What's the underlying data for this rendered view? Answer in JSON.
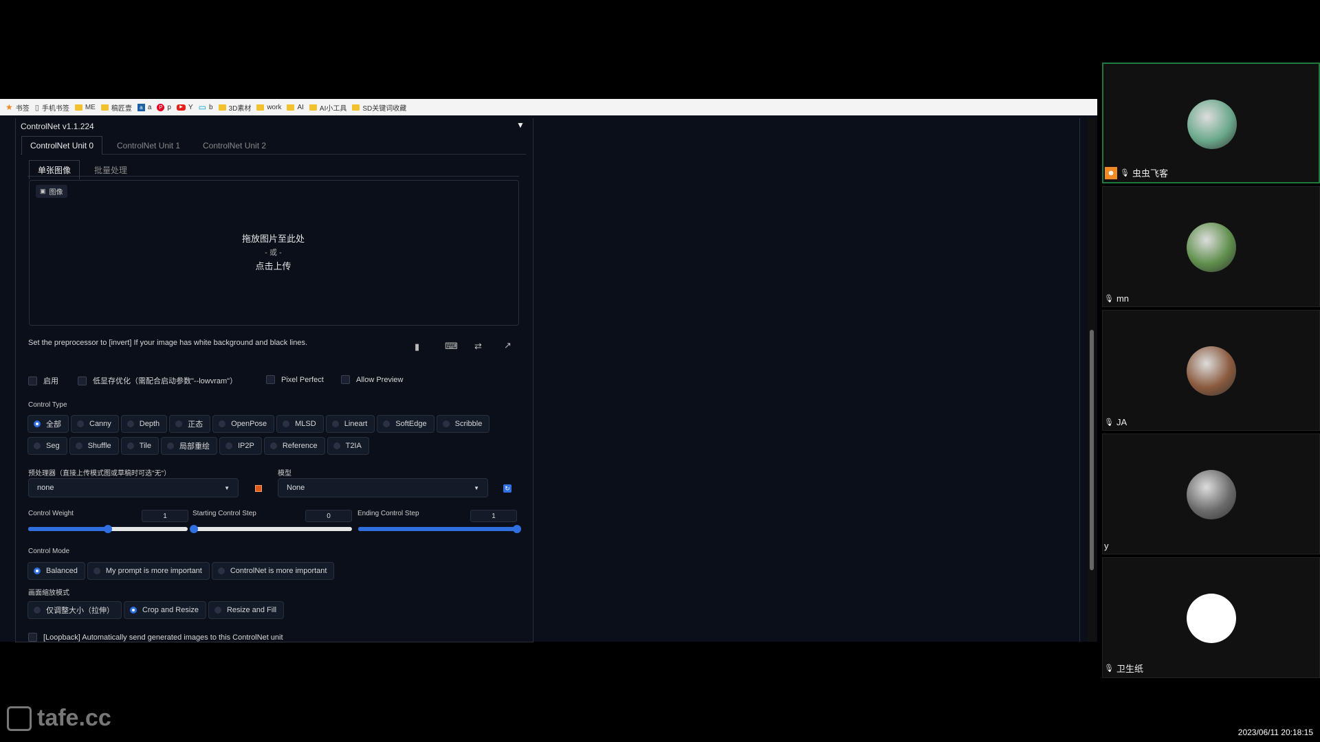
{
  "bookmarks": [
    {
      "label": "书签",
      "icon": "star-icon"
    },
    {
      "label": "手机书签",
      "icon": "phone-icon"
    },
    {
      "label": "ME",
      "icon": "folder-icon"
    },
    {
      "label": "稿匠壹",
      "icon": "folder-icon"
    },
    {
      "label": "a",
      "icon": "a-icon"
    },
    {
      "label": "p",
      "icon": "pinterest-icon"
    },
    {
      "label": "Y",
      "icon": "youtube-icon"
    },
    {
      "label": "b",
      "icon": "bilibili-icon"
    },
    {
      "label": "3D素材",
      "icon": "folder-icon"
    },
    {
      "label": "work",
      "icon": "folder-icon"
    },
    {
      "label": "AI",
      "icon": "folder-icon"
    },
    {
      "label": "AI小工具",
      "icon": "folder-icon"
    },
    {
      "label": "SD关键词收藏",
      "icon": "folder-icon"
    }
  ],
  "controlnet": {
    "title": "ControlNet v1.1.224",
    "collapse_icon": "▼",
    "units": [
      "ControlNet Unit 0",
      "ControlNet Unit 1",
      "ControlNet Unit 2"
    ],
    "image_tabs": [
      "单张图像",
      "批量处理"
    ],
    "image_label": "图像",
    "drop": {
      "line1": "拖放图片至此处",
      "line2": "- 或 -",
      "line3": "点击上传"
    },
    "hint": "Set the preprocessor to [invert] If your image has white background and black lines.",
    "checkboxes": [
      "启用",
      "低显存优化（需配合启动参数\"--lowvram\"）",
      "Pixel Perfect",
      "Allow Preview"
    ],
    "control_type_label": "Control Type",
    "control_types_row1": [
      "全部",
      "Canny",
      "Depth",
      "正态",
      "OpenPose",
      "MLSD",
      "Lineart",
      "SoftEdge",
      "Scribble"
    ],
    "control_types_row2": [
      "Seg",
      "Shuffle",
      "Tile",
      "局部重绘",
      "IP2P",
      "Reference",
      "T2IA"
    ],
    "control_type_selected": "全部",
    "preprocessor_label": "预处理器（直接上传模式图或草稿时可选\"无\"）",
    "preprocessor_value": "none",
    "model_label": "模型",
    "model_value": "None",
    "weight": {
      "label": "Control Weight",
      "value": "1",
      "fraction": 0.5
    },
    "start": {
      "label": "Starting Control Step",
      "value": "0",
      "fraction": 0.0
    },
    "end": {
      "label": "Ending Control Step",
      "value": "1",
      "fraction": 1.0
    },
    "control_mode_label": "Control Mode",
    "control_modes": [
      "Balanced",
      "My prompt is more important",
      "ControlNet is more important"
    ],
    "control_mode_selected": "Balanced",
    "resize_label": "画面缩放模式",
    "resize_modes": [
      "仅调整大小（拉伸）",
      "Crop and Resize",
      "Resize and Fill"
    ],
    "resize_selected": "Crop and Resize",
    "loopback": "[Loopback] Automatically send generated images to this ControlNet unit"
  },
  "participants": [
    {
      "name": "虫虫飞客",
      "active": true,
      "avatar_color": "#6aa88a"
    },
    {
      "name": "mn",
      "active": false,
      "avatar_color": "#5f8f4c"
    },
    {
      "name": "JA",
      "active": false,
      "avatar_color": "#8a5a3e"
    },
    {
      "name": "y",
      "active": false,
      "avatar_color": "#6b6b6b"
    },
    {
      "name": "卫生纸",
      "active": false,
      "avatar_color": "#ffffff"
    }
  ],
  "watermark": "tafe.cc",
  "clock": "2023/06/11 20:18:15",
  "colors": {
    "accent": "#2f6fe0",
    "app_bg": "#0b0f19",
    "active_tile": "#1f7a3e"
  }
}
